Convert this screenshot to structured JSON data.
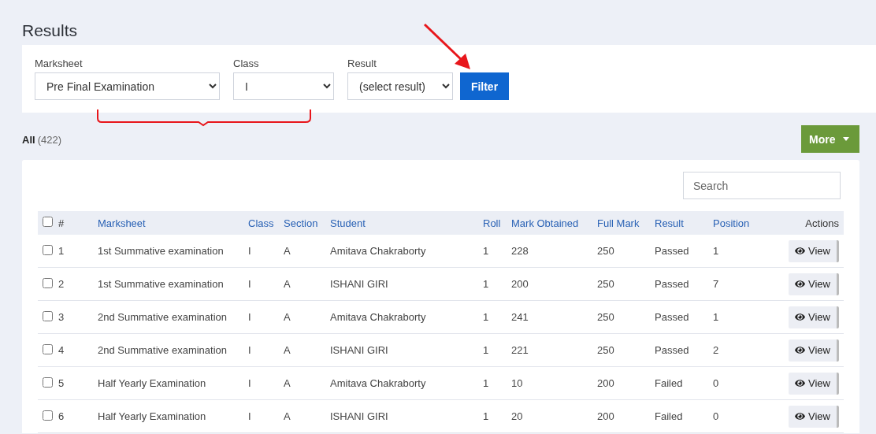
{
  "page": {
    "title": "Results"
  },
  "filters": [
    {
      "label": "Marksheet",
      "value": "Pre Final Examination"
    },
    {
      "label": "Class",
      "value": "I"
    },
    {
      "label": "Result",
      "value": "(select result)"
    }
  ],
  "filter_button": "Filter",
  "count": {
    "label": "All",
    "value": "(422)"
  },
  "more_button": "More",
  "search": {
    "placeholder": "Search"
  },
  "table": {
    "select_all_checked": false,
    "columns": [
      "#",
      "Marksheet",
      "Class",
      "Section",
      "Student",
      "Roll",
      "Mark Obtained",
      "Full Mark",
      "Result",
      "Position",
      "Actions"
    ],
    "rows": [
      {
        "checked": false,
        "cells": [
          "1",
          "1st Summative examination",
          "I",
          "A",
          "Amitava Chakraborty",
          "1",
          "228",
          "250",
          "Passed",
          "1"
        ],
        "action": "View"
      },
      {
        "checked": false,
        "cells": [
          "2",
          "1st Summative examination",
          "I",
          "A",
          "ISHANI GIRI",
          "1",
          "200",
          "250",
          "Passed",
          "7"
        ],
        "action": "View"
      },
      {
        "checked": false,
        "cells": [
          "3",
          "2nd Summative examination",
          "I",
          "A",
          "Amitava Chakraborty",
          "1",
          "241",
          "250",
          "Passed",
          "1"
        ],
        "action": "View"
      },
      {
        "checked": false,
        "cells": [
          "4",
          "2nd Summative examination",
          "I",
          "A",
          "ISHANI GIRI",
          "1",
          "221",
          "250",
          "Passed",
          "2"
        ],
        "action": "View"
      },
      {
        "checked": false,
        "cells": [
          "5",
          "Half Yearly Examination",
          "I",
          "A",
          "Amitava Chakraborty",
          "1",
          "10",
          "200",
          "Failed",
          "0"
        ],
        "action": "View"
      },
      {
        "checked": false,
        "cells": [
          "6",
          "Half Yearly Examination",
          "I",
          "A",
          "ISHANI GIRI",
          "1",
          "20",
          "200",
          "Failed",
          "0"
        ],
        "action": "View"
      }
    ]
  }
}
